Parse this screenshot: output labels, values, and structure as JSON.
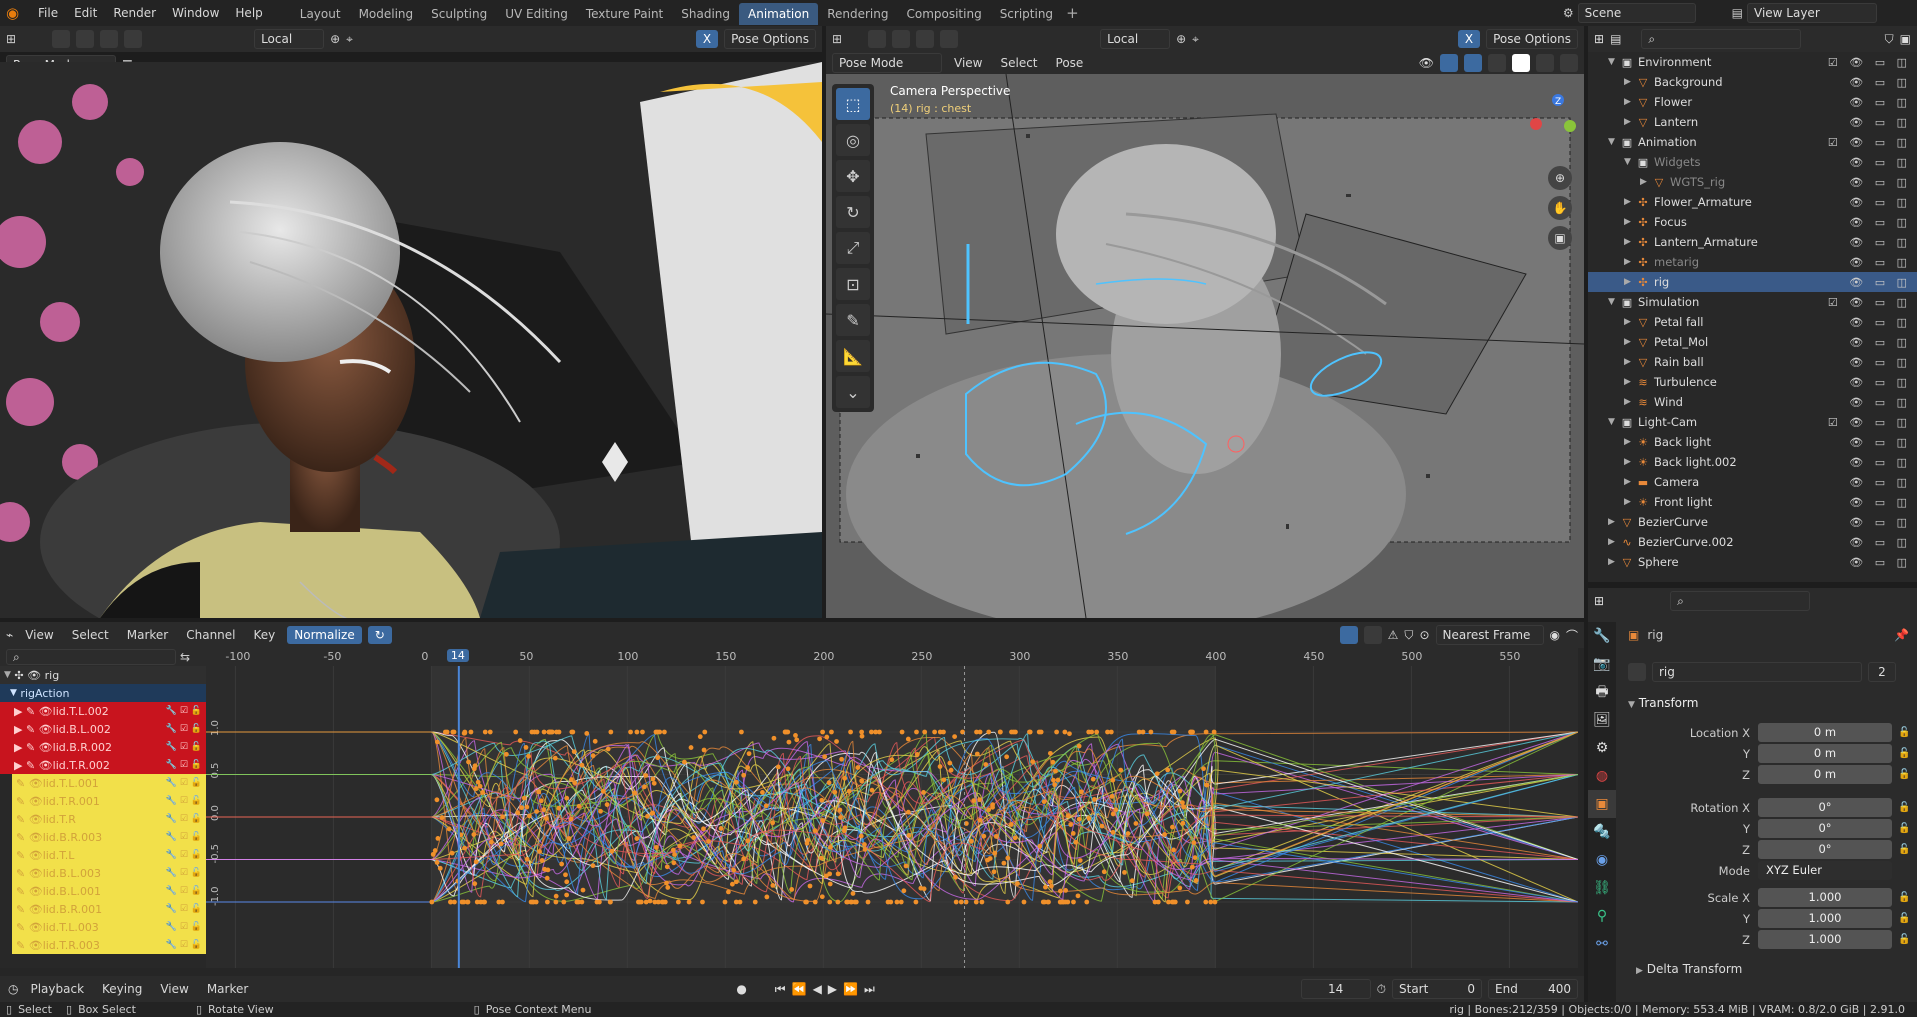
{
  "menu": [
    "File",
    "Edit",
    "Render",
    "Window",
    "Help"
  ],
  "workspaces": [
    "Layout",
    "Modeling",
    "Sculpting",
    "UV Editing",
    "Texture Paint",
    "Shading",
    "Animation",
    "Rendering",
    "Compositing",
    "Scripting"
  ],
  "active_workspace": "Animation",
  "scene": "Scene",
  "view_layer": "View Layer",
  "vp1": {
    "mode": "Pose Mode",
    "transform": "Local",
    "pose_options": "Pose Options"
  },
  "vp2": {
    "mode": "Pose Mode",
    "menus": [
      "View",
      "Select",
      "Pose"
    ],
    "transform": "Local",
    "pose_options": "Pose Options",
    "overlay_title": "Camera Perspective",
    "overlay_sub": "(14) rig : chest"
  },
  "outliner": {
    "rows": [
      {
        "label": "Environment",
        "indent": 1,
        "type": "collection",
        "check": true
      },
      {
        "label": "Background",
        "indent": 2,
        "type": "mesh"
      },
      {
        "label": "Flower",
        "indent": 2,
        "type": "mesh"
      },
      {
        "label": "Lantern",
        "indent": 2,
        "type": "mesh"
      },
      {
        "label": "Animation",
        "indent": 1,
        "type": "collection",
        "check": true
      },
      {
        "label": "Widgets",
        "indent": 2,
        "type": "collection",
        "dim": true
      },
      {
        "label": "WGTS_rig",
        "indent": 3,
        "type": "mesh",
        "dim": true
      },
      {
        "label": "Flower_Armature",
        "indent": 2,
        "type": "armature"
      },
      {
        "label": "Focus",
        "indent": 2,
        "type": "armature"
      },
      {
        "label": "Lantern_Armature",
        "indent": 2,
        "type": "armature"
      },
      {
        "label": "metarig",
        "indent": 2,
        "type": "armature",
        "dim": true
      },
      {
        "label": "rig",
        "indent": 2,
        "type": "armature",
        "selected": true
      },
      {
        "label": "Simulation",
        "indent": 1,
        "type": "collection",
        "check": true
      },
      {
        "label": "Petal fall",
        "indent": 2,
        "type": "mesh"
      },
      {
        "label": "Petal_Mol",
        "indent": 2,
        "type": "mesh"
      },
      {
        "label": "Rain ball",
        "indent": 2,
        "type": "mesh"
      },
      {
        "label": "Turbulence",
        "indent": 2,
        "type": "force"
      },
      {
        "label": "Wind",
        "indent": 2,
        "type": "force"
      },
      {
        "label": "Light-Cam",
        "indent": 1,
        "type": "collection",
        "check": true
      },
      {
        "label": "Back light",
        "indent": 2,
        "type": "light"
      },
      {
        "label": "Back light.002",
        "indent": 2,
        "type": "light"
      },
      {
        "label": "Camera",
        "indent": 2,
        "type": "camera"
      },
      {
        "label": "Front light",
        "indent": 2,
        "type": "light"
      },
      {
        "label": "BezierCurve",
        "indent": 1,
        "type": "mesh"
      },
      {
        "label": "BezierCurve.002",
        "indent": 1,
        "type": "curve"
      },
      {
        "label": "Sphere",
        "indent": 1,
        "type": "mesh"
      }
    ]
  },
  "properties": {
    "object_name": "rig",
    "data_name": "rig",
    "users": "2",
    "panel": "Transform",
    "location": [
      {
        "label": "Location X",
        "value": "0 m"
      },
      {
        "label": "Y",
        "value": "0 m"
      },
      {
        "label": "Z",
        "value": "0 m"
      }
    ],
    "rotation": [
      {
        "label": "Rotation X",
        "value": "0°"
      },
      {
        "label": "Y",
        "value": "0°"
      },
      {
        "label": "Z",
        "value": "0°"
      }
    ],
    "mode_label": "Mode",
    "mode_value": "XYZ Euler",
    "scale": [
      {
        "label": "Scale X",
        "value": "1.000"
      },
      {
        "label": "Y",
        "value": "1.000"
      },
      {
        "label": "Z",
        "value": "1.000"
      }
    ],
    "delta": "Delta Transform"
  },
  "graph": {
    "menus": [
      "View",
      "Select",
      "Marker",
      "Channel",
      "Key"
    ],
    "normalize": "Normalize",
    "interp": "Nearest Frame",
    "frame_ticks": [
      "-100",
      "-50",
      "0",
      "50",
      "100",
      "150",
      "200",
      "250",
      "300",
      "350",
      "400",
      "450",
      "500",
      "550"
    ],
    "current_frame": "14",
    "y_ticks": [
      "1.0",
      "0.5",
      "0.0",
      "-0.5",
      "-1.0"
    ],
    "channels_root": "rig",
    "action": "rigAction",
    "red_channels": [
      "lid.T.L.002",
      "lid.B.L.002",
      "lid.B.R.002",
      "lid.T.R.002"
    ],
    "yellow_channels": [
      "lid.T.L.001",
      "lid.T.R.001",
      "lid.T.R",
      "lid.B.R.003",
      "lid.T.L",
      "lid.B.L.003",
      "lid.B.L.001",
      "lid.B.R.001",
      "lid.T.L.003",
      "lid.T.R.003"
    ]
  },
  "timeline": {
    "menus": [
      "Playback",
      "Keying",
      "View",
      "Marker"
    ],
    "frame": "14",
    "start_label": "Start",
    "start": "0",
    "end_label": "End",
    "end": "400"
  },
  "status": {
    "select": "Select",
    "box": "Box Select",
    "rotate": "Rotate View",
    "context": "Pose Context Menu",
    "info": "rig | Bones:212/359 | Objects:0/0 | Memory: 553.4 MiB | VRAM: 0.8/2.0 GiB | 2.91.0"
  }
}
